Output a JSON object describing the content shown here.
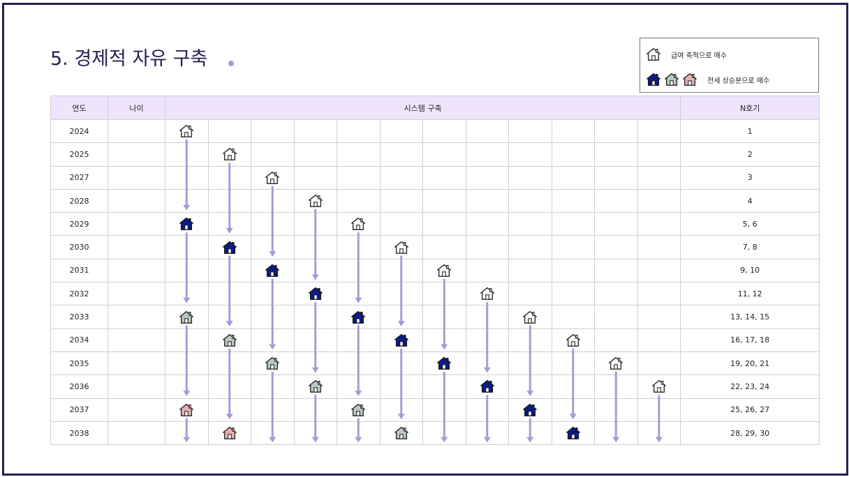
{
  "title": "5. 경제적 자유 구축",
  "legend": {
    "item1": "급여 축적으로 매수",
    "item2": "전세 상승분으로 매수"
  },
  "table": {
    "headers": {
      "year": "연도",
      "age": "나이",
      "system": "시스템 구축",
      "n": "N호기"
    },
    "rows": [
      {
        "year": "2024",
        "age": "",
        "n": "1"
      },
      {
        "year": "2025",
        "age": "",
        "n": "2"
      },
      {
        "year": "2027",
        "age": "",
        "n": "3"
      },
      {
        "year": "2028",
        "age": "",
        "n": "4"
      },
      {
        "year": "2029",
        "age": "",
        "n": "5, 6"
      },
      {
        "year": "2030",
        "age": "",
        "n": "7, 8"
      },
      {
        "year": "2031",
        "age": "",
        "n": "9, 10"
      },
      {
        "year": "2032",
        "age": "",
        "n": "11, 12"
      },
      {
        "year": "2033",
        "age": "",
        "n": "13, 14, 15"
      },
      {
        "year": "2034",
        "age": "",
        "n": "16, 17, 18"
      },
      {
        "year": "2035",
        "age": "",
        "n": "19, 20, 21"
      },
      {
        "year": "2036",
        "age": "",
        "n": "22, 23, 24"
      },
      {
        "year": "2037",
        "age": "",
        "n": "25, 26, 27"
      },
      {
        "year": "2038",
        "age": "",
        "n": "28, 29, 30"
      }
    ]
  },
  "houses": [
    {
      "row": 0,
      "col": 0,
      "type": "white"
    },
    {
      "row": 1,
      "col": 1,
      "type": "white"
    },
    {
      "row": 2,
      "col": 2,
      "type": "white"
    },
    {
      "row": 3,
      "col": 3,
      "type": "white"
    },
    {
      "row": 4,
      "col": 4,
      "type": "white"
    },
    {
      "row": 5,
      "col": 5,
      "type": "white"
    },
    {
      "row": 6,
      "col": 6,
      "type": "white"
    },
    {
      "row": 7,
      "col": 7,
      "type": "white"
    },
    {
      "row": 8,
      "col": 8,
      "type": "white"
    },
    {
      "row": 9,
      "col": 9,
      "type": "white"
    },
    {
      "row": 10,
      "col": 10,
      "type": "white"
    },
    {
      "row": 11,
      "col": 11,
      "type": "white"
    },
    {
      "row": 4,
      "col": 0,
      "type": "navy"
    },
    {
      "row": 5,
      "col": 1,
      "type": "navy"
    },
    {
      "row": 6,
      "col": 2,
      "type": "navy"
    },
    {
      "row": 7,
      "col": 3,
      "type": "navy"
    },
    {
      "row": 8,
      "col": 4,
      "type": "navy"
    },
    {
      "row": 9,
      "col": 5,
      "type": "navy"
    },
    {
      "row": 10,
      "col": 6,
      "type": "navy"
    },
    {
      "row": 11,
      "col": 7,
      "type": "navy"
    },
    {
      "row": 12,
      "col": 8,
      "type": "navy"
    },
    {
      "row": 13,
      "col": 9,
      "type": "navy"
    },
    {
      "row": 8,
      "col": 0,
      "type": "gray"
    },
    {
      "row": 9,
      "col": 1,
      "type": "gray"
    },
    {
      "row": 10,
      "col": 2,
      "type": "gray"
    },
    {
      "row": 11,
      "col": 3,
      "type": "gray"
    },
    {
      "row": 12,
      "col": 4,
      "type": "gray"
    },
    {
      "row": 13,
      "col": 5,
      "type": "gray"
    },
    {
      "row": 12,
      "col": 0,
      "type": "pink"
    },
    {
      "row": 13,
      "col": 1,
      "type": "pink"
    }
  ],
  "colors": {
    "header_bg": "#efe4fb",
    "arrow": "#a99ad6",
    "navy": "#0a1a8f",
    "gray": "#b9c9c3",
    "pink": "#e9b2b2",
    "frame": "#2a1d52"
  }
}
